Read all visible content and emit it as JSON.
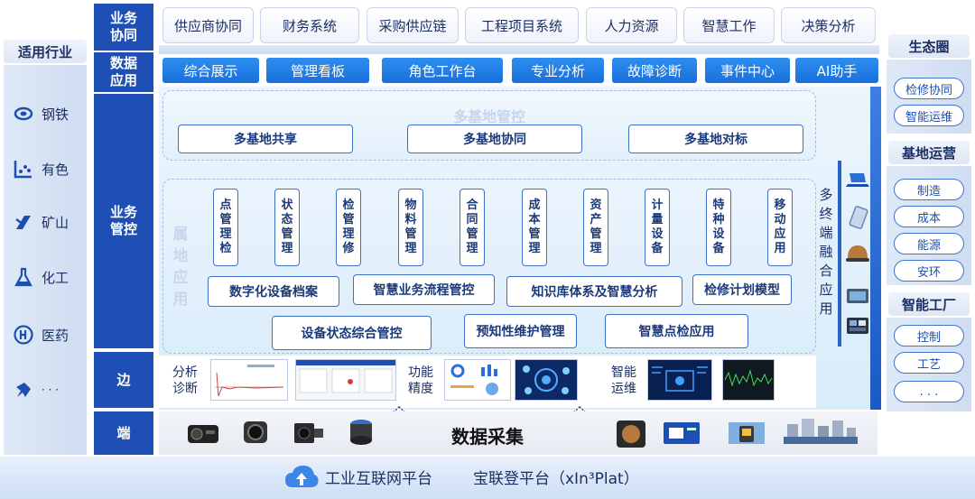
{
  "industry": {
    "title": "适用行业",
    "items": [
      {
        "label": "钢铁",
        "icon": "steel-icon"
      },
      {
        "label": "有色",
        "icon": "nonferrous-icon"
      },
      {
        "label": "矿山",
        "icon": "mine-icon"
      },
      {
        "label": "化工",
        "icon": "chemical-icon"
      },
      {
        "label": "医药",
        "icon": "pharma-icon"
      },
      {
        "label": "· · ·",
        "icon": "more-icon"
      }
    ]
  },
  "layers": {
    "business_collab": "业务协同",
    "data_app": "数据应用",
    "business_control": "业务管控",
    "edge": "边",
    "terminal": "端"
  },
  "top_buttons": [
    "供应商协同",
    "财务系统",
    "采购供应链",
    "工程项目系统",
    "人力资源",
    "智慧工作",
    "决策分析"
  ],
  "app_buttons": [
    "综合展示",
    "管理看板",
    "角色工作台",
    "专业分析",
    "故障诊断",
    "事件中心",
    "AI助手"
  ],
  "multi_base": {
    "title": "多基地管控",
    "buttons": [
      "多基地共享",
      "多基地协同",
      "多基地对标"
    ]
  },
  "local_app": {
    "title": "属地应用",
    "vertical": [
      "点管理检",
      "状态管理",
      "检管理修",
      "物料管理",
      "合同管理",
      "成本管理",
      "资产管理",
      "计量设备",
      "特种设备",
      "移动应用"
    ],
    "row1": [
      "数字化设备档案",
      "智慧业务流程管控",
      "知识库体系及智慧分析",
      "检修计划模型"
    ],
    "row2": [
      "设备状态综合管控",
      "预知性维护管理",
      "智慧点检应用"
    ]
  },
  "multi_terminal": {
    "label": "多终端融合应用",
    "icons": [
      "laptop-icon",
      "tablet-icon",
      "helmet-icon",
      "handheld-icon",
      "monitor-icon"
    ]
  },
  "edge": {
    "groups": [
      "分析诊断",
      "功能精度",
      "智能运维"
    ]
  },
  "data_collect": "数据采集",
  "platform": {
    "left": "工业互联网平台",
    "right": "宝联登平台（xIn³Plat）"
  },
  "ecosystem": {
    "title": "生态圈",
    "buttons": [
      "检修协同",
      "智能运维"
    ]
  },
  "base_ops": {
    "title": "基地运营",
    "buttons": [
      "制造",
      "成本",
      "能源",
      "安环"
    ]
  },
  "smart_factory": {
    "title": "智能工厂",
    "buttons": [
      "控制",
      "工艺",
      ". . ."
    ]
  },
  "colors": {
    "layer_blue": "#1e4fb5",
    "app_blue": "#1a6fdc",
    "border_blue": "#3c70c8"
  }
}
